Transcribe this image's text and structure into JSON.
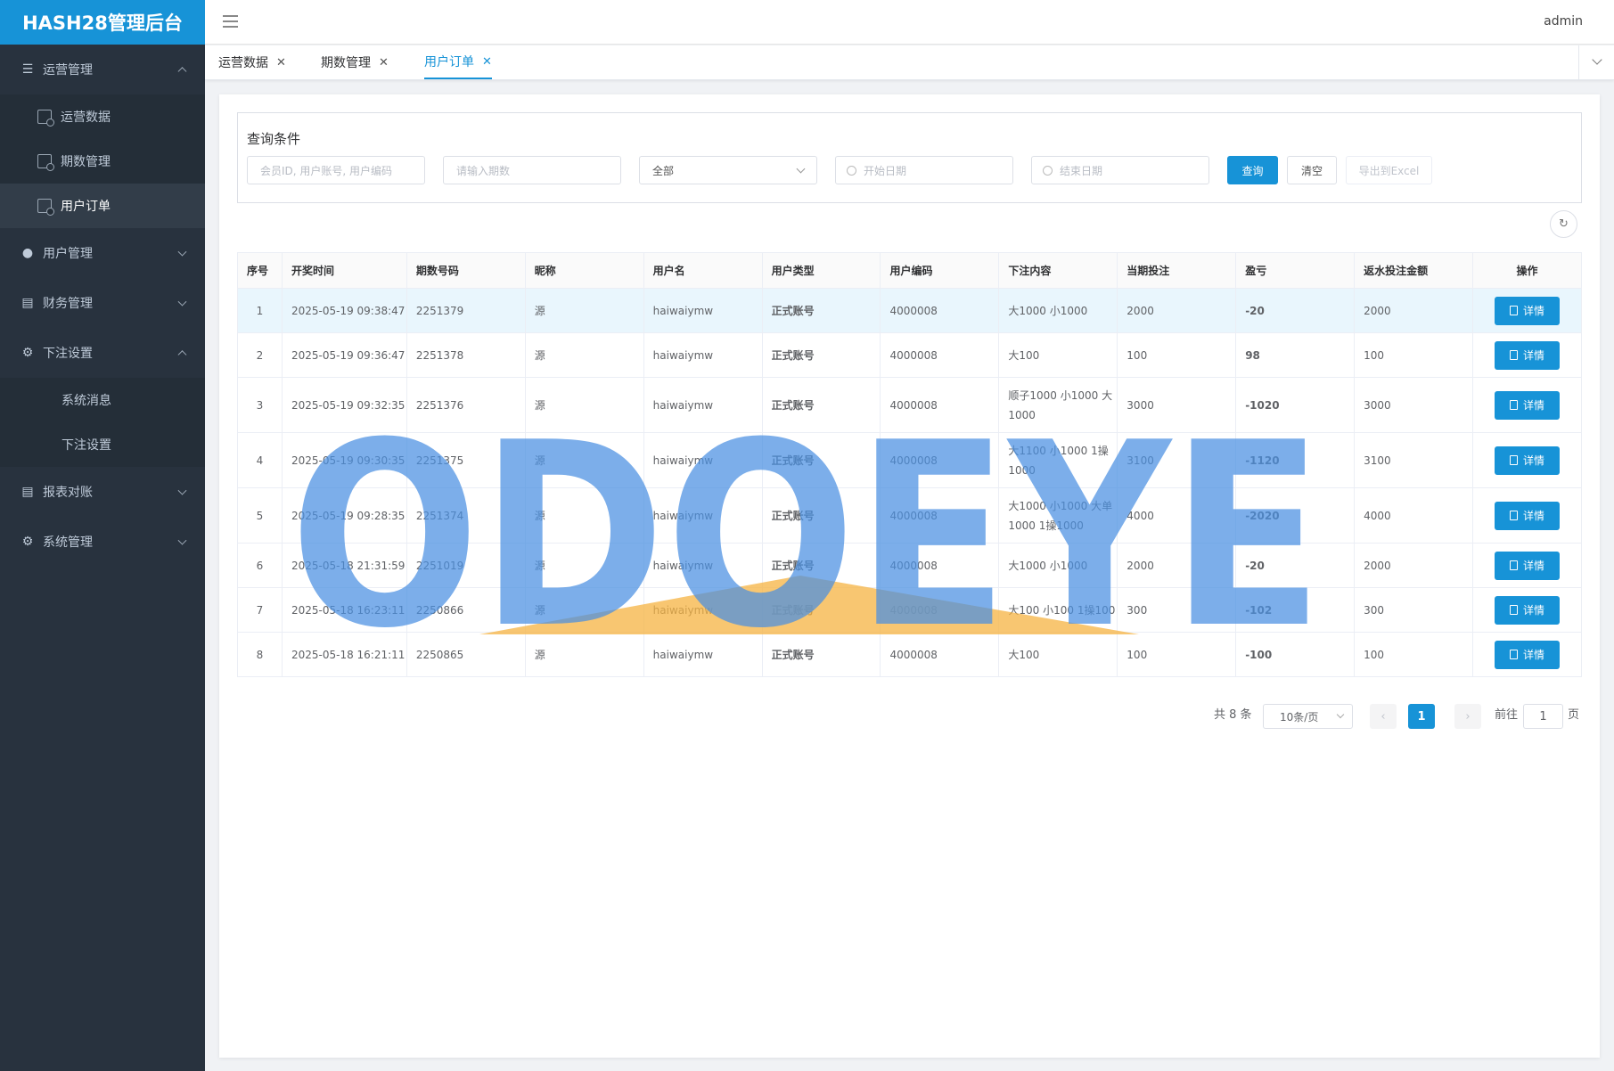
{
  "app": {
    "title": "HASH28管理后台",
    "user": "admin"
  },
  "sidebar": {
    "groups": [
      {
        "label": "运营管理",
        "icon": "list-icon",
        "expanded": true,
        "items": [
          {
            "label": "运营数据"
          },
          {
            "label": "期数管理"
          },
          {
            "label": "用户订单",
            "active": true
          }
        ]
      },
      {
        "label": "用户管理",
        "icon": "user-icon",
        "expanded": false,
        "items": []
      },
      {
        "label": "财务管理",
        "icon": "document-icon",
        "expanded": false,
        "items": []
      },
      {
        "label": "下注设置",
        "icon": "gear-icon",
        "expanded": true,
        "items": [
          {
            "label": "系统消息"
          },
          {
            "label": "下注设置"
          }
        ]
      },
      {
        "label": "报表对账",
        "icon": "report-icon",
        "expanded": false,
        "items": []
      },
      {
        "label": "系统管理",
        "icon": "gear-icon",
        "expanded": false,
        "items": []
      }
    ]
  },
  "tabs": [
    {
      "label": "运营数据",
      "active": false
    },
    {
      "label": "期数管理",
      "active": false
    },
    {
      "label": "用户订单",
      "active": true
    }
  ],
  "query": {
    "title": "查询条件",
    "member_placeholder": "会员ID, 用户账号, 用户编码",
    "period_placeholder": "请输入期数",
    "type_value": "全部",
    "start_placeholder": "开始日期",
    "end_placeholder": "结束日期",
    "search_label": "查询",
    "clear_label": "清空",
    "export_label": "导出到Excel"
  },
  "table": {
    "columns": [
      "序号",
      "开奖时间",
      "期数号码",
      "昵称",
      "用户名",
      "用户类型",
      "用户编码",
      "下注内容",
      "当期投注",
      "盈亏",
      "返水投注金额",
      "操作"
    ],
    "detail_label": "详情",
    "rows": [
      {
        "no": "1",
        "time": "2025-05-19 09:38:47",
        "period": "2251379",
        "nick": "源",
        "username": "haiwaiymw",
        "type": "正式账号",
        "code": "4000008",
        "content": "大1000 小1000",
        "bet": "2000",
        "pnl": "-20",
        "pnl_sign": "neg",
        "rebate": "2000"
      },
      {
        "no": "2",
        "time": "2025-05-19 09:36:47",
        "period": "2251378",
        "nick": "源",
        "username": "haiwaiymw",
        "type": "正式账号",
        "code": "4000008",
        "content": "大100",
        "bet": "100",
        "pnl": "98",
        "pnl_sign": "pos",
        "rebate": "100"
      },
      {
        "no": "3",
        "time": "2025-05-19 09:32:35",
        "period": "2251376",
        "nick": "源",
        "username": "haiwaiymw",
        "type": "正式账号",
        "code": "4000008",
        "content": "顺子1000 小1000 大1000",
        "bet": "3000",
        "pnl": "-1020",
        "pnl_sign": "neg",
        "rebate": "3000"
      },
      {
        "no": "4",
        "time": "2025-05-19 09:30:35",
        "period": "2251375",
        "nick": "源",
        "username": "haiwaiymw",
        "type": "正式账号",
        "code": "4000008",
        "content": "大1100 小1000 1操1000",
        "bet": "3100",
        "pnl": "-1120",
        "pnl_sign": "neg",
        "rebate": "3100"
      },
      {
        "no": "5",
        "time": "2025-05-19 09:28:35",
        "period": "2251374",
        "nick": "源",
        "username": "haiwaiymw",
        "type": "正式账号",
        "code": "4000008",
        "content": "大1000 小1000 大单1000 1操1000",
        "bet": "4000",
        "pnl": "-2020",
        "pnl_sign": "neg",
        "rebate": "4000"
      },
      {
        "no": "6",
        "time": "2025-05-18 21:31:59",
        "period": "2251019",
        "nick": "源",
        "username": "haiwaiymw",
        "type": "正式账号",
        "code": "4000008",
        "content": "大1000 小1000",
        "bet": "2000",
        "pnl": "-20",
        "pnl_sign": "neg",
        "rebate": "2000"
      },
      {
        "no": "7",
        "time": "2025-05-18 16:23:11",
        "period": "2250866",
        "nick": "源",
        "username": "haiwaiymw",
        "type": "正式账号",
        "code": "4000008",
        "content": "大100 小100 1操100",
        "bet": "300",
        "pnl": "-102",
        "pnl_sign": "neg",
        "rebate": "300"
      },
      {
        "no": "8",
        "time": "2025-05-18 16:21:11",
        "period": "2250865",
        "nick": "源",
        "username": "haiwaiymw",
        "type": "正式账号",
        "code": "4000008",
        "content": "大100",
        "bet": "100",
        "pnl": "-100",
        "pnl_sign": "neg",
        "rebate": "100"
      }
    ]
  },
  "pagination": {
    "total_label": "共 8 条",
    "page_size": "10条/页",
    "current_page": "1",
    "goto_prefix": "前往",
    "goto_value": "1",
    "goto_suffix": "页"
  },
  "watermark": {
    "text": "ODOEYE",
    "color": "#4a90e2",
    "accent": "#f5b342"
  },
  "colors": {
    "primary": "#1793d7",
    "sidebar": "#28323e",
    "positive": "#d22a2a",
    "negative": "#20a046"
  }
}
